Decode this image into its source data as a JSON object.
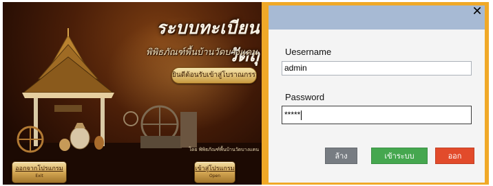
{
  "splash": {
    "title": "ระบบทะเบียนวัตถุ",
    "subtitle": "พิพิธภัณฑ์พื้นบ้านวัดบางแคน",
    "welcome": "ยินดีต้อนรับเข้าสู่โบราณกรรม",
    "credit": "โดย พิพิธภัณฑ์พื้นบ้านวัดบางแคน",
    "exit_button": {
      "label_th": "ออกจากโปรแกรม",
      "label_en": "Exit"
    },
    "open_button": {
      "label_th": "เข้าสู่โปรแกรม",
      "label_en": "Open"
    }
  },
  "dialog": {
    "close_glyph": "✕",
    "username_label": "Uesername",
    "username_value": "admin",
    "password_label": "Password",
    "password_value": "*****",
    "buttons": {
      "clear": "ล้าง",
      "login": "เข้าระบบ",
      "quit": "ออก"
    }
  },
  "colors": {
    "dialog_frame": "#f0a928",
    "dialog_header": "#a7bad4",
    "clear_button": "#777c82",
    "login_button": "#45a74f",
    "quit_button": "#e24b2b"
  }
}
